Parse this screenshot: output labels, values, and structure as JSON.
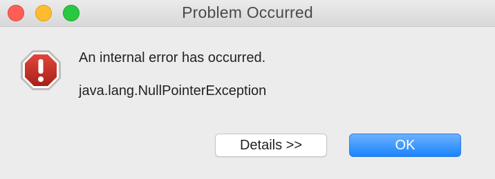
{
  "window": {
    "title": "Problem Occurred"
  },
  "traffic_lights": {
    "close_color": "#fd5f57",
    "minimize_color": "#febc2e",
    "zoom_color": "#2ac840"
  },
  "dialog": {
    "icon": "error-stop-sign-icon",
    "icon_color": "#c8322a",
    "message": "An internal error has occurred.",
    "detail": "java.lang.NullPointerException"
  },
  "buttons": {
    "details_label": "Details >>",
    "ok_label": "OK",
    "ok_color": "#1a84fd"
  }
}
